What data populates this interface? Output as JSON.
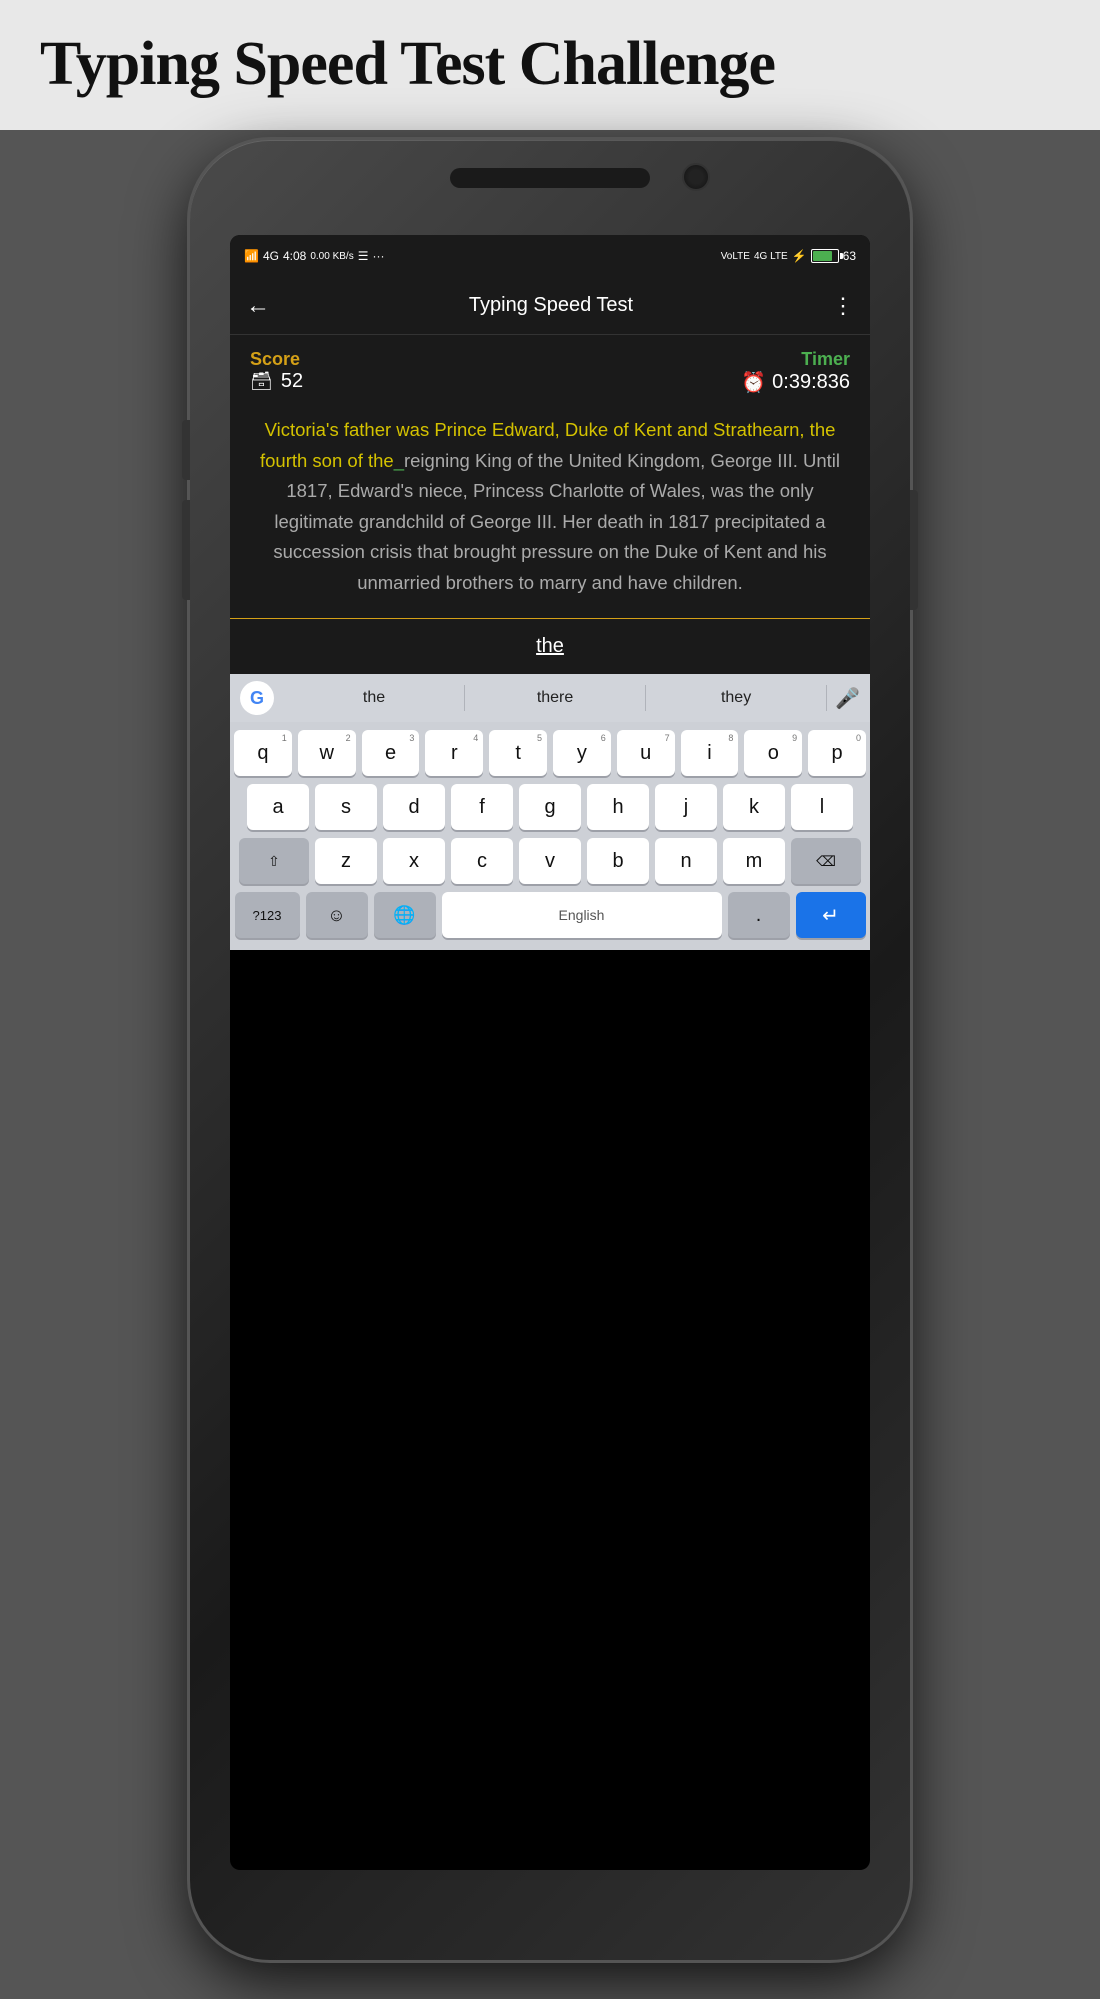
{
  "page": {
    "title": "Typing Speed Test Challenge"
  },
  "statusBar": {
    "signal": "4G",
    "time": "4:08",
    "dataSpeed": "0.00 KB/s",
    "volte": "VoLTE",
    "lte": "4G LTE",
    "battery": "63"
  },
  "appBar": {
    "title": "Typing Speed Test",
    "backArrow": "←",
    "moreIcon": "⋮"
  },
  "score": {
    "label": "Score",
    "icon": "🗃",
    "value": "52"
  },
  "timer": {
    "label": "Timer",
    "icon": "⏰",
    "value": "0:39:836"
  },
  "passage": {
    "typed": "Victoria's father was Prince Edward, Duke of Kent and Strathearn, the fourth son of the",
    "current": "_",
    "remaining": "reigning King of the United Kingdom, George III. Until 1817, Edward's niece, Princess Charlotte of Wales, was the only legitimate grandchild of George III. Her death in 1817 precipitated a succession crisis that brought pressure on the Duke of Kent and his unmarried brothers to marry and have children."
  },
  "inputWord": "the",
  "suggestions": {
    "word1": "the",
    "word2": "there",
    "word3": "they"
  },
  "keyboard": {
    "row1": [
      {
        "char": "q",
        "num": "1"
      },
      {
        "char": "w",
        "num": "2"
      },
      {
        "char": "e",
        "num": "3"
      },
      {
        "char": "r",
        "num": "4"
      },
      {
        "char": "t",
        "num": "5"
      },
      {
        "char": "y",
        "num": "6"
      },
      {
        "char": "u",
        "num": "7"
      },
      {
        "char": "i",
        "num": "8"
      },
      {
        "char": "o",
        "num": "9"
      },
      {
        "char": "p",
        "num": "0"
      }
    ],
    "row2": [
      {
        "char": "a"
      },
      {
        "char": "s"
      },
      {
        "char": "d"
      },
      {
        "char": "f"
      },
      {
        "char": "g"
      },
      {
        "char": "h"
      },
      {
        "char": "j"
      },
      {
        "char": "k"
      },
      {
        "char": "l"
      }
    ],
    "row3": [
      {
        "char": "z"
      },
      {
        "char": "x"
      },
      {
        "char": "c"
      },
      {
        "char": "v"
      },
      {
        "char": "b"
      },
      {
        "char": "n"
      },
      {
        "char": "m"
      }
    ],
    "bottomRow": {
      "special": "?123",
      "emoji": "☺",
      "globe": "🌐",
      "space": "English",
      "period": ".",
      "enter": "↵"
    }
  }
}
